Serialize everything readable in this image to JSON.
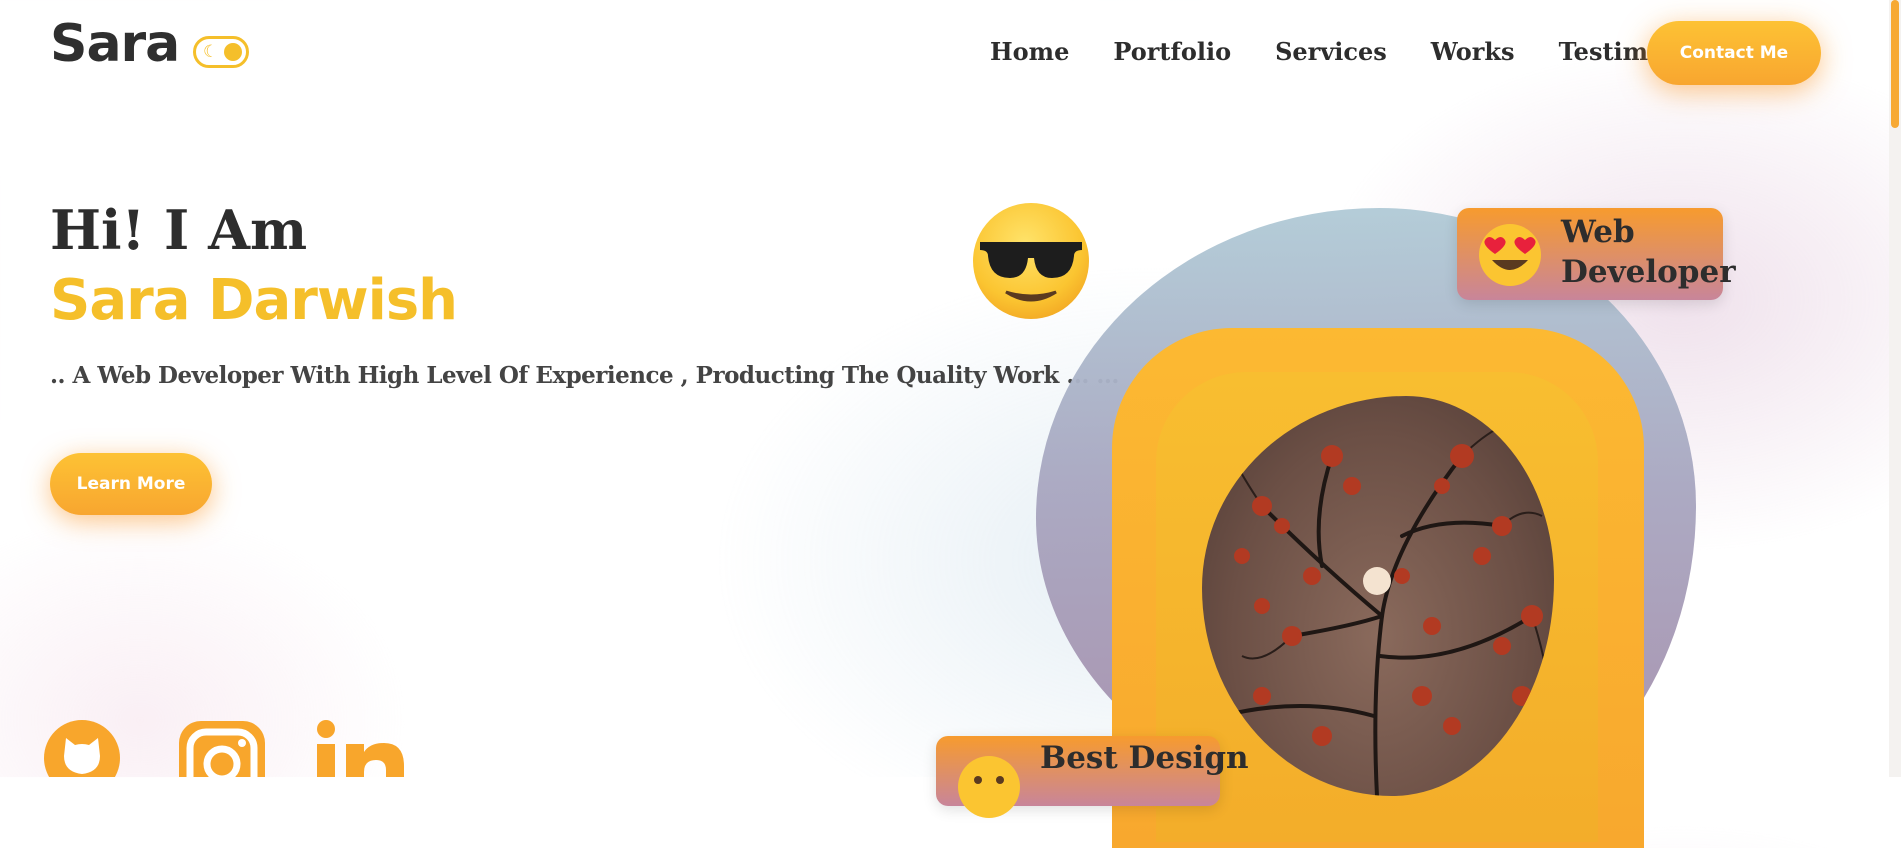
{
  "header": {
    "logo": "Sara",
    "nav": [
      "Home",
      "Portfolio",
      "Services",
      "Works",
      "Testimonials"
    ],
    "contact_label": "Contact Me"
  },
  "hero": {
    "greeting": "Hi! I Am",
    "name": "Sara Darwish",
    "tagline": ".. A Web Developer With High Level Of Experience , Producting The Quality Work ... ...",
    "cta_label": "Learn More"
  },
  "badges": {
    "web": "Web Developer",
    "design": "Best Design"
  },
  "social": [
    "github-icon",
    "instagram-icon",
    "linkedin-icon"
  ],
  "colors": {
    "accent": "#f5bf2a",
    "accent_dark": "#f8a630",
    "text": "#2d2d2d"
  }
}
